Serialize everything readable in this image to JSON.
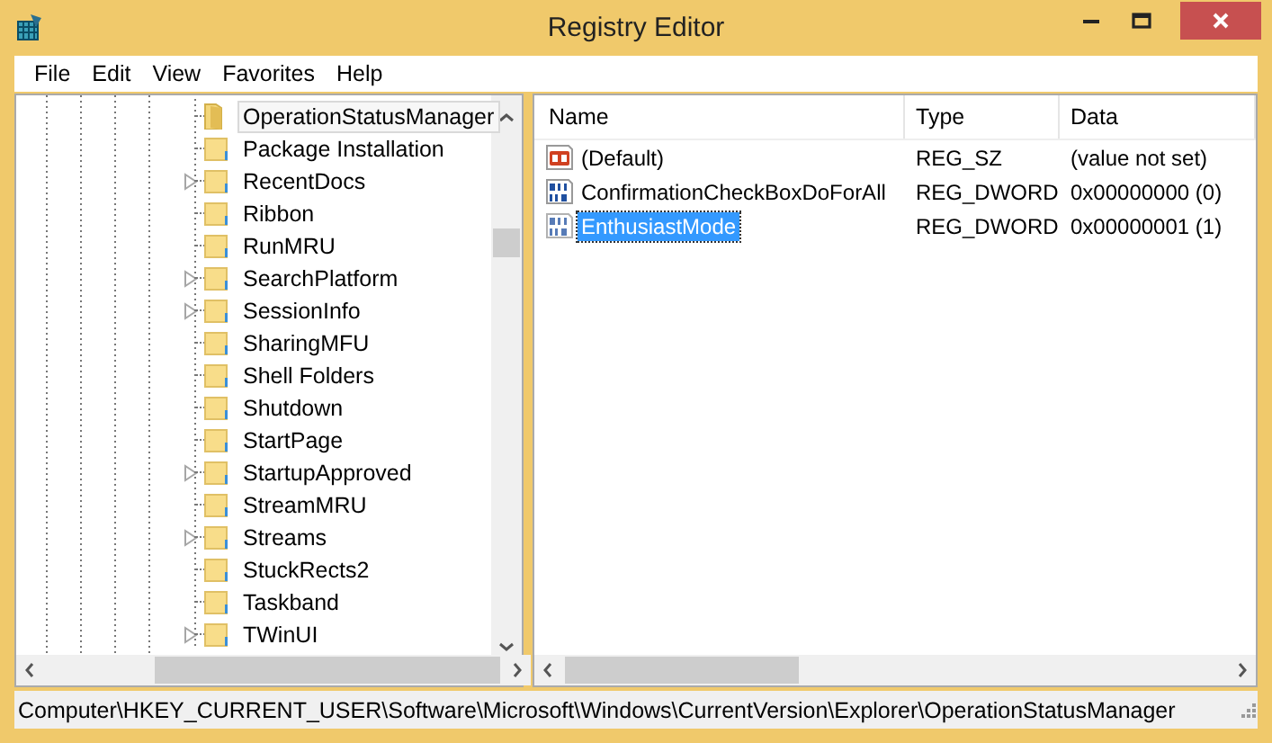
{
  "window": {
    "title": "Registry Editor"
  },
  "menu": [
    "File",
    "Edit",
    "View",
    "Favorites",
    "Help"
  ],
  "tree": {
    "items": [
      {
        "label": "OperationStatusManager",
        "expandable": false,
        "selected": true
      },
      {
        "label": "Package Installation",
        "expandable": false,
        "selected": false
      },
      {
        "label": "RecentDocs",
        "expandable": true,
        "selected": false
      },
      {
        "label": "Ribbon",
        "expandable": false,
        "selected": false
      },
      {
        "label": "RunMRU",
        "expandable": false,
        "selected": false
      },
      {
        "label": "SearchPlatform",
        "expandable": true,
        "selected": false
      },
      {
        "label": "SessionInfo",
        "expandable": true,
        "selected": false
      },
      {
        "label": "SharingMFU",
        "expandable": false,
        "selected": false
      },
      {
        "label": "Shell Folders",
        "expandable": false,
        "selected": false
      },
      {
        "label": "Shutdown",
        "expandable": false,
        "selected": false
      },
      {
        "label": "StartPage",
        "expandable": false,
        "selected": false
      },
      {
        "label": "StartupApproved",
        "expandable": true,
        "selected": false
      },
      {
        "label": "StreamMRU",
        "expandable": false,
        "selected": false
      },
      {
        "label": "Streams",
        "expandable": true,
        "selected": false
      },
      {
        "label": "StuckRects2",
        "expandable": false,
        "selected": false
      },
      {
        "label": "Taskband",
        "expandable": false,
        "selected": false
      },
      {
        "label": "TWinUI",
        "expandable": true,
        "selected": false
      }
    ]
  },
  "values": {
    "columns": [
      "Name",
      "Type",
      "Data"
    ],
    "rows": [
      {
        "kind": "string",
        "name": "(Default)",
        "type": "REG_SZ",
        "data": "(value not set)",
        "selected": false
      },
      {
        "kind": "binary",
        "name": "ConfirmationCheckBoxDoForAll",
        "type": "REG_DWORD",
        "data": "0x00000000 (0)",
        "selected": false
      },
      {
        "kind": "binary",
        "name": "EnthusiastMode",
        "type": "REG_DWORD",
        "data": "0x00000001 (1)",
        "selected": true
      }
    ]
  },
  "status_bar": "Computer\\HKEY_CURRENT_USER\\Software\\Microsoft\\Windows\\CurrentVersion\\Explorer\\OperationStatusManager"
}
